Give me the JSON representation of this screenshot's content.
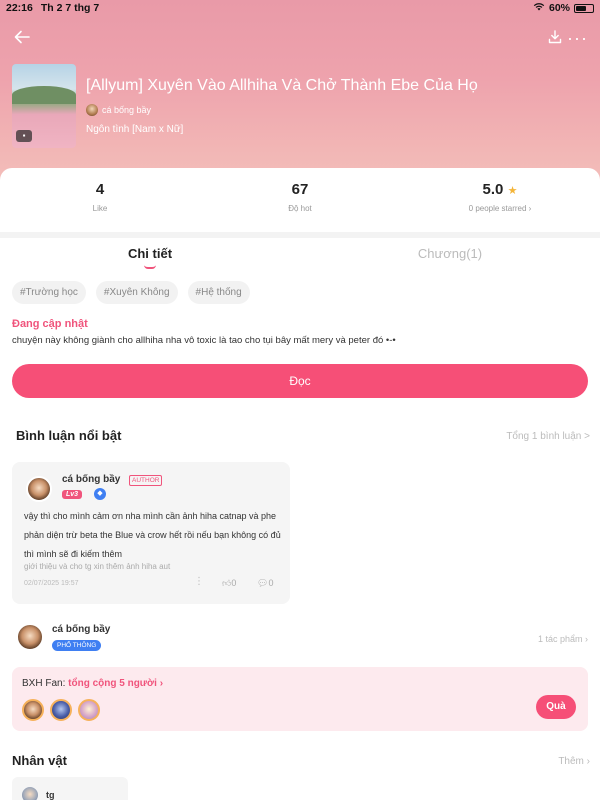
{
  "status_bar": {
    "time": "22:16",
    "date": "Th 2 7 thg 7",
    "battery": "60%",
    "battery_level": 0.6
  },
  "header": {
    "back_icon": "back-arrow-icon",
    "download_icon": "download-icon",
    "more_icon": "more-icon",
    "title": "[Allyum] Xuyên Vào Allhiha Và Chở Thành Ebe Của Họ",
    "author": "cá bống bầy",
    "genre": "Ngôn tình [Nam x Nữ]"
  },
  "stats": {
    "likes_value": "4",
    "likes_label": "Like",
    "hot_value": "67",
    "hot_label": "Độ hot",
    "rating_value": "5.0",
    "rating_label": "0 people starred ›"
  },
  "tabs": [
    {
      "label": "Chi tiết",
      "active": true
    },
    {
      "label": "Chương(1)",
      "active": false
    }
  ],
  "tags": [
    "#Trường học",
    "#Xuyên Không",
    "#Hệ thống"
  ],
  "update": {
    "title": "Đang cập nhật",
    "description": "chuyện này không giành cho allhiha nha vô toxic là tao cho tụi bây mất mery và peter đó •-•"
  },
  "read_button": "Đọc",
  "comments_section": {
    "title": "Bình luận nổi bật",
    "total_link": "Tổng 1 bình luận >",
    "comment": {
      "user": "cá bống bầy",
      "author_tag": "AUTHOR",
      "level": "Lv3",
      "text": "vậy thì cho mình cảm ơn nha mình cần ảnh hiha catnap và phe phản diện trừ beta the Blue và crow hết rồi nếu bạn không có đủ thì mình sẽ đi kiếm thêm",
      "sub": "giới thiệu và cho tg xin thêm ảnh hiha aut",
      "date": "02/07/2025 19:57",
      "likes": "0",
      "replies": "0"
    }
  },
  "author_block": {
    "name": "cá bống bầy",
    "badge": "PHỔ THÔNG",
    "works_link": "1 tác phẩm ›"
  },
  "fans": {
    "label": "BXH Fan:",
    "highlight": "tổng cộng 5 người ›",
    "gift_button": "Quà"
  },
  "characters": {
    "title": "Nhân vật",
    "more_link": "Thêm ›",
    "first_name": "tg"
  }
}
